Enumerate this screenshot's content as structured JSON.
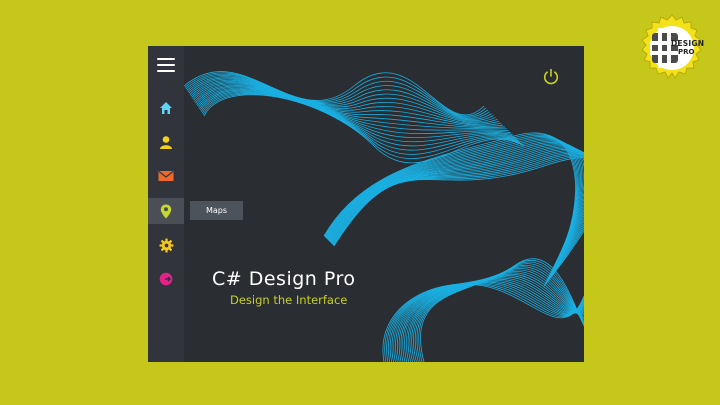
{
  "badge": {
    "line1": "DESIGN",
    "line2": "PRO"
  },
  "sidebar": {
    "items": [
      {
        "name": "home",
        "icon": "home-icon",
        "color": "#5fd3f5"
      },
      {
        "name": "user",
        "icon": "user-icon",
        "color": "#f4d21c"
      },
      {
        "name": "mail",
        "icon": "mail-icon",
        "color": "#ee6a2a"
      },
      {
        "name": "maps",
        "icon": "map-pin-icon",
        "color": "#c6d92a",
        "active": true
      },
      {
        "name": "settings",
        "icon": "gear-icon",
        "color": "#f6c81e"
      },
      {
        "name": "exit",
        "icon": "exit-icon",
        "color": "#e4218a"
      }
    ]
  },
  "tooltip": {
    "label": "Maps"
  },
  "main": {
    "title": "C# Design Pro",
    "subtitle": "Design the Interface"
  },
  "colors": {
    "background": "#c5c81b",
    "window": "#2a2d31",
    "sidebar": "#31353b",
    "wave": "#1ab7ec",
    "accent": "#c7d023"
  }
}
